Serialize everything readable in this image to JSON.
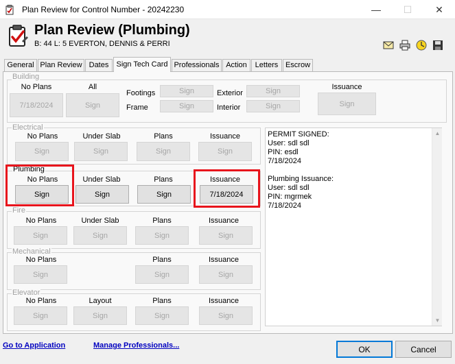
{
  "window": {
    "title": "Plan Review for Control Number - 20242230",
    "minimize": "—",
    "maximize": "☐",
    "close": "✕"
  },
  "header": {
    "title": "Plan Review (Plumbing)",
    "subtitle": "B: 44  L: 5  EVERTON, DENNIS & PERRI",
    "icons": [
      "email-icon",
      "print-icon",
      "clock-icon",
      "save-icon"
    ]
  },
  "tabs": [
    {
      "label": "General"
    },
    {
      "label": "Plan Review"
    },
    {
      "label": "Dates"
    },
    {
      "label": "Sign Tech Card"
    },
    {
      "label": "Professionals"
    },
    {
      "label": "Action"
    },
    {
      "label": "Letters"
    },
    {
      "label": "Escrow"
    }
  ],
  "active_tab": "Sign Tech Card",
  "building": {
    "label": "Building",
    "no_plans_label": "No Plans",
    "no_plans_value": "7/18/2024",
    "all_label": "All",
    "all_button": "Sign",
    "footings_label": "Footings",
    "footings_button": "Sign",
    "frame_label": "Frame",
    "frame_button": "Sign",
    "exterior_label": "Exterior",
    "exterior_button": "Sign",
    "interior_label": "Interior",
    "interior_button": "Sign",
    "issuance_label": "Issuance",
    "issuance_button": "Sign"
  },
  "electrical": {
    "label": "Electrical",
    "cols": [
      "No Plans",
      "Under Slab",
      "Plans",
      "Issuance"
    ],
    "buttons": [
      "Sign",
      "Sign",
      "Sign",
      "Sign"
    ]
  },
  "plumbing": {
    "label": "Plumbing",
    "cols": [
      "No Plans",
      "Under Slab",
      "Plans",
      "Issuance"
    ],
    "buttons": [
      "Sign",
      "Sign",
      "Sign",
      "7/18/2024"
    ]
  },
  "fire": {
    "label": "Fire",
    "cols": [
      "No Plans",
      "Under Slab",
      "Plans",
      "Issuance"
    ],
    "buttons": [
      "Sign",
      "Sign",
      "Sign",
      "Sign"
    ]
  },
  "mechanical": {
    "label": "Mechanical",
    "cols": [
      "No Plans",
      "Plans",
      "Issuance"
    ],
    "buttons": [
      "Sign",
      "Sign",
      "Sign"
    ]
  },
  "elevator": {
    "label": "Elevator",
    "cols": [
      "No Plans",
      "Layout",
      "Plans",
      "Issuance"
    ],
    "buttons": [
      "Sign",
      "Sign",
      "Sign",
      "Sign"
    ]
  },
  "log": {
    "text": "PERMIT SIGNED:\nUser: sdl sdl\nPIN: esdl\n7/18/2024\n\nPlumbing Issuance:\nUser: sdl sdl\nPIN: mgrmek\n7/18/2024"
  },
  "footer": {
    "go_to_application": "Go to Application",
    "manage_professionals": "Manage Professionals...",
    "ok": "OK",
    "cancel": "Cancel"
  },
  "colors": {
    "highlight": "#e8141c",
    "link": "#0000c0",
    "focus": "#0078d7"
  }
}
